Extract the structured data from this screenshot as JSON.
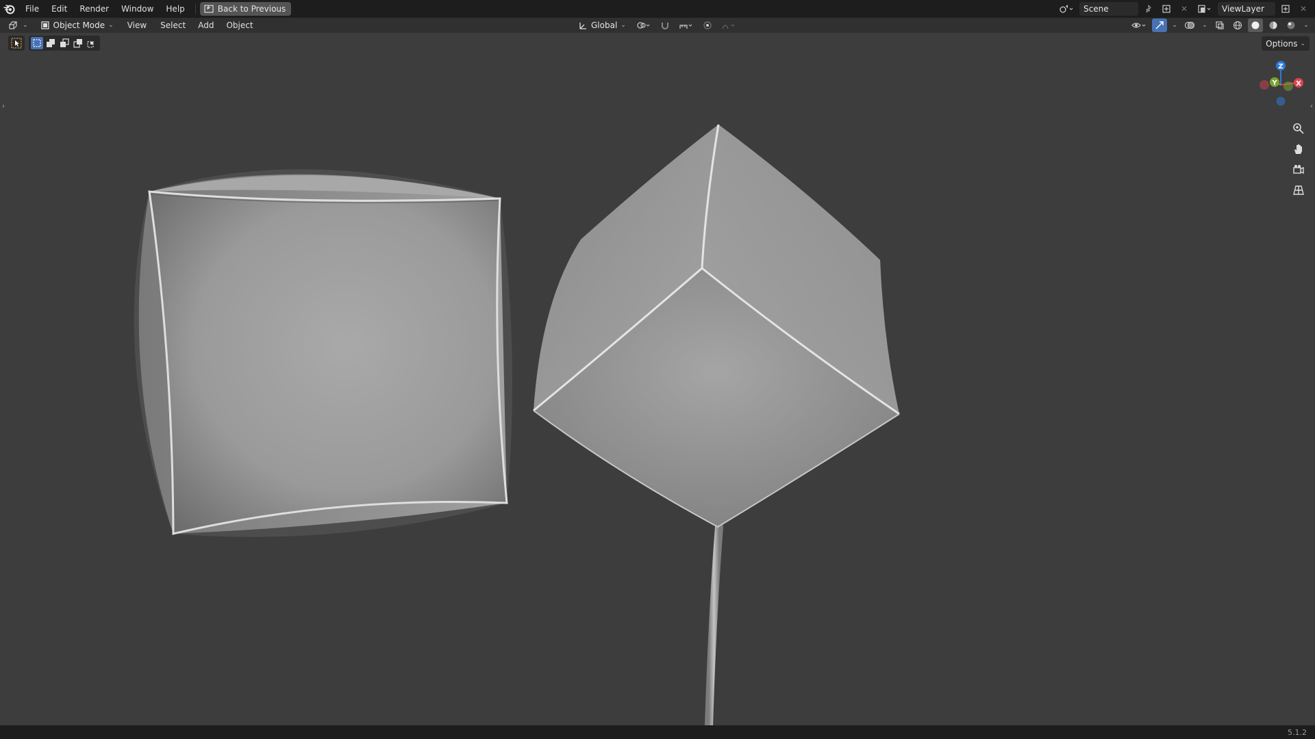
{
  "menubar": {
    "logo_icon": "blender-logo-icon",
    "items": [
      {
        "label": "File"
      },
      {
        "label": "Edit"
      },
      {
        "label": "Render"
      },
      {
        "label": "Window"
      },
      {
        "label": "Help"
      }
    ],
    "back_button": "Back to Previous",
    "scene_name": "Scene",
    "view_layer_name": "ViewLayer"
  },
  "header": {
    "mode": "Object Mode",
    "menus": [
      {
        "label": "View"
      },
      {
        "label": "Select"
      },
      {
        "label": "Add"
      },
      {
        "label": "Object"
      }
    ],
    "transform_orientation": "Global"
  },
  "toolbar": {
    "options_label": "Options"
  },
  "gizmo": {
    "axes": [
      "Z",
      "Y",
      "X"
    ],
    "colors": {
      "x": "#e0434f",
      "y": "#79a333",
      "z": "#2f7ad6"
    }
  },
  "viewport": {
    "background": "#3d3d3d",
    "objects": [
      {
        "name": "inflated-cube"
      },
      {
        "name": "inflated-balloon"
      }
    ]
  },
  "statusbar": {
    "version": "5.1.2"
  }
}
